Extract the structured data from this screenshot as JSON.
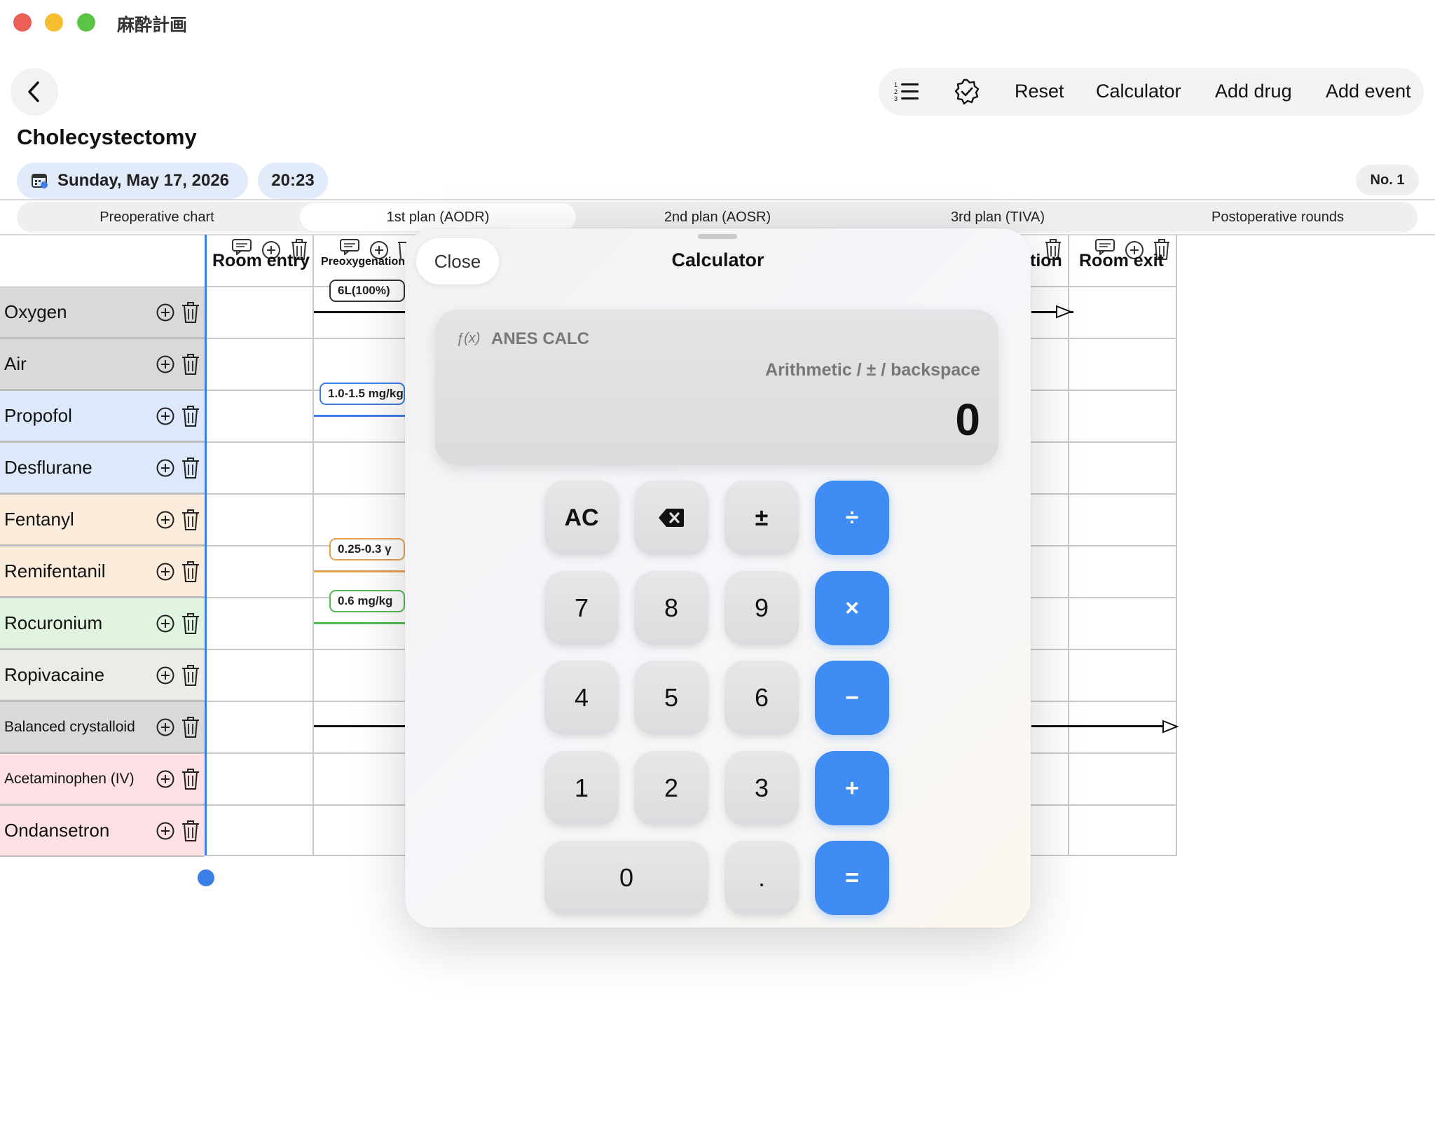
{
  "window": {
    "title": "麻酔計画"
  },
  "toolbar": {
    "icons": [
      "numbered-list-icon",
      "verified-badge-icon"
    ],
    "reset": "Reset",
    "calculator": "Calculator",
    "add_drug": "Add drug",
    "add_event": "Add event"
  },
  "header": {
    "title": "Cholecystectomy",
    "date": "Sunday, May 17, 2026",
    "time": "20:23",
    "number": "No. 1"
  },
  "tabs": [
    "Preoperative chart",
    "1st plan (AODR)",
    "2nd plan (AOSR)",
    "3rd plan (TIVA)",
    "Postoperative rounds"
  ],
  "active_tab": "1st plan (AODR)",
  "grid": {
    "columns": [
      "Room entry",
      "Preoxygenation",
      "tion",
      "Room exit"
    ],
    "drugs": [
      {
        "name": "Oxygen",
        "color": "#d9d9d9"
      },
      {
        "name": "Air",
        "color": "#d9d9d9"
      },
      {
        "name": "Propofol",
        "color": "#dde8fb"
      },
      {
        "name": "Desflurane",
        "color": "#dde8fb"
      },
      {
        "name": "Fentanyl",
        "color": "#fcecdc"
      },
      {
        "name": "Remifentanil",
        "color": "#fcecdc"
      },
      {
        "name": "Rocuronium",
        "color": "#e0f4e0"
      },
      {
        "name": "Ropivacaine",
        "color": "#ecebe6"
      },
      {
        "name": "Balanced crystalloid",
        "color": "#d9d9d9"
      },
      {
        "name": "Acetaminophen (IV)",
        "color": "#fde1e4"
      },
      {
        "name": "Ondansetron",
        "color": "#fde1e4"
      }
    ],
    "doses": {
      "oxygen": "6L(100%)",
      "propofol": "1.0-1.5 mg/kg",
      "remifentanil": "0.25-0.3 γ",
      "rocuronium": "0.6 mg/kg"
    }
  },
  "calculator": {
    "close": "Close",
    "title": "Calculator",
    "fx": "ƒ(x)",
    "brand": "ANES CALC",
    "hint": "Arithmetic / ± / backspace",
    "value": "0",
    "keys": {
      "ac": "AC",
      "plusminus": "±",
      "divide": "÷",
      "k7": "7",
      "k8": "8",
      "k9": "9",
      "multiply": "×",
      "k4": "4",
      "k5": "5",
      "k6": "6",
      "minus": "−",
      "k1": "1",
      "k2": "2",
      "k3": "3",
      "plus": "+",
      "k0": "0",
      "dot": ".",
      "equals": "="
    }
  }
}
